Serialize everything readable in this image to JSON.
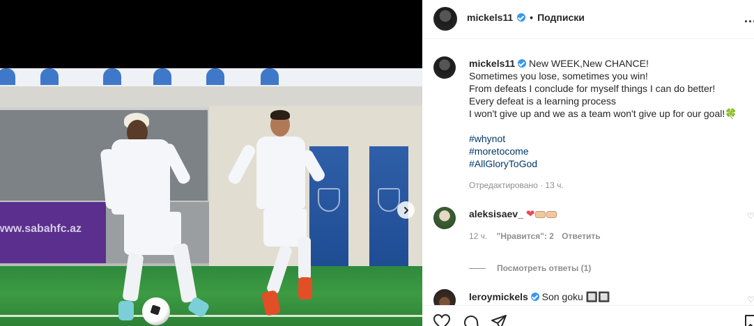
{
  "post": {
    "author": "mickels11",
    "follow_label": "Подписки",
    "more_label": "...",
    "separator": "•"
  },
  "media": {
    "ad_board_text": "www.sabahfc.az"
  },
  "caption": {
    "author": "mickels11",
    "lines": [
      "New WEEK,New CHANCE!",
      "Sometimes you lose, sometimes you win!",
      "From defeats I conclude for myself things I can do better!",
      "Every defeat is a learning process",
      "I won't give up and we as a team won't give up for our goal!🍀"
    ],
    "hashtags": [
      "#whynot",
      "#moretocome",
      "#AllGloryToGod"
    ],
    "edited": "Отредактировано · 13 ч."
  },
  "comments": [
    {
      "user": "aleksisaev_",
      "time": "12 ч.",
      "likes": "\"Нравится\": 2",
      "reply": "Ответить",
      "view_replies": "Посмотреть ответы (1)"
    },
    {
      "user": "leroymickels",
      "text": "Son goku 🔲🔲"
    }
  ],
  "icons": [
    "heart-icon",
    "comment-icon",
    "share-icon",
    "bookmark-icon",
    "chevron-right-icon",
    "more-icon",
    "verified-icon"
  ],
  "colors": {
    "link": "#00376b",
    "verified": "#3897f0",
    "muted": "#8e8e8e"
  }
}
